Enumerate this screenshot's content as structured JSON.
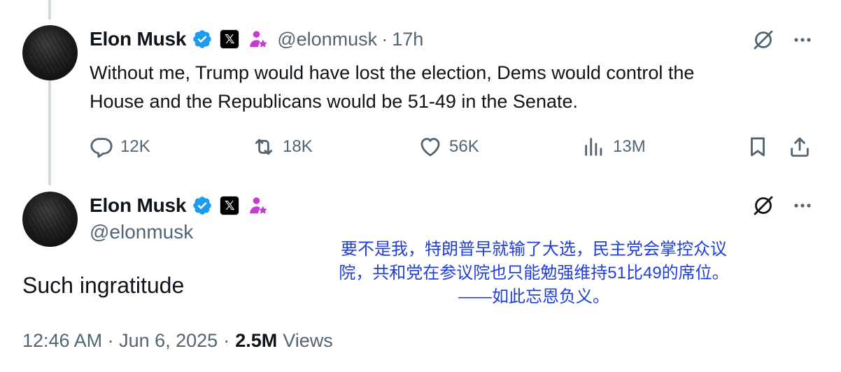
{
  "reply_tweet": {
    "author_name": "Elon Musk",
    "handle": "@elonmusk",
    "separator": "·",
    "time_ago": "17h",
    "text_line1": "Without me, Trump would have lost the election, Dems would control the",
    "text_line2": "House and the Republicans would be 51-49 in the Senate.",
    "actions": {
      "replies": "12K",
      "reposts": "18K",
      "likes": "56K",
      "views": "13M"
    }
  },
  "main_tweet": {
    "author_name": "Elon Musk",
    "handle": "@elonmusk",
    "text": "Such ingratitude",
    "timestamp": "12:46 AM · Jun 6, 2025",
    "separator": "·",
    "views_count": "2.5M",
    "views_label": "Views"
  },
  "translation_overlay": {
    "line1": "要不是我，特朗普早就输了大选，民主党会掌控众议",
    "line2": "院，共和党在参议院也只能勉强维持51比49的席位。",
    "line3": "——如此忘恩负义。",
    "color": "#1f3fd6"
  },
  "colors": {
    "verified": "#1d9bf0",
    "muted": "#536471",
    "text": "#0f1419",
    "gov_badge": "#c43bcf"
  },
  "icons": {
    "verified": "verified-badge-icon",
    "x_badge": "x-logo-badge-icon",
    "affiliate": "person-star-badge-icon",
    "grok": "grok-icon",
    "more": "more-dots-icon",
    "reply": "reply-bubble-icon",
    "repost": "repost-arrows-icon",
    "like": "heart-icon",
    "analytics": "bar-chart-icon",
    "bookmark": "bookmark-icon",
    "share": "share-upload-icon",
    "x_badge_glyph": "𝕏"
  }
}
